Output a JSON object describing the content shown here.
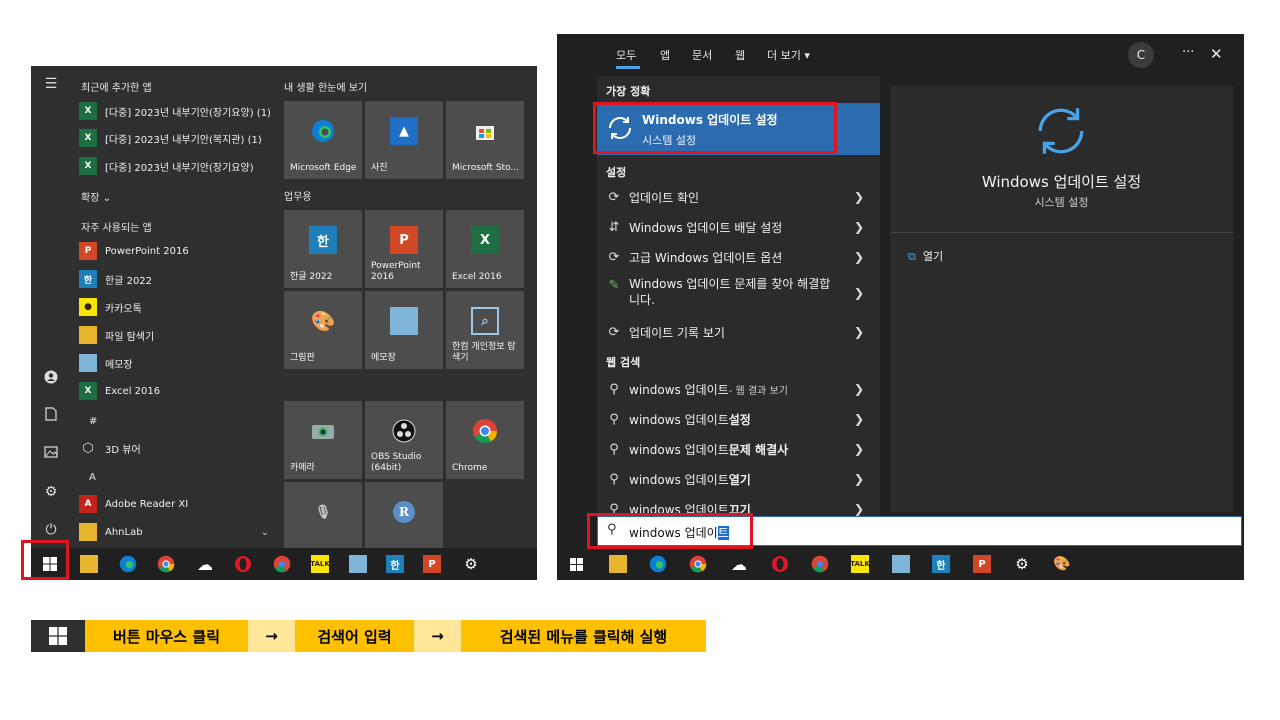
{
  "start_menu": {
    "recent_header": "최근에 추가한 앱",
    "recent": [
      "[다중] 2023년 내부기안(장기요양) (1)",
      "[다중] 2023년 내부기안(복지관) (1)",
      "[다중] 2023년 내부기안(장기요양)"
    ],
    "expand": "확장",
    "frequent_header": "자주 사용되는 앱",
    "frequent": [
      "PowerPoint 2016",
      "한글 2022",
      "카카오톡",
      "파일 탐색기",
      "메모장",
      "Excel 2016"
    ],
    "letter_hash": "#",
    "item_3d": "3D 뷰어",
    "letter_a": "A",
    "adobe": "Adobe Reader XI",
    "ahnlab": "AhnLab",
    "group1": "내 생활 한눈에 보기",
    "tiles1": [
      "Microsoft Edge",
      "사진",
      "Microsoft Sto..."
    ],
    "group2": "업무용",
    "tiles2": [
      "한글 2022",
      "PowerPoint 2016",
      "Excel 2016"
    ],
    "tiles3": [
      "그림판",
      "메모장",
      "한컴 개인정보 탐색기"
    ],
    "tiles4": [
      "카메라",
      "OBS Studio (64bit)",
      "Chrome"
    ]
  },
  "search": {
    "tabs": [
      "모두",
      "앱",
      "문서",
      "웹",
      "더 보기"
    ],
    "user_initial": "C",
    "more": "···",
    "close": "✕",
    "best_match_header": "가장 정확",
    "best_title": "Windows 업데이트 설정",
    "best_sub": "시스템 설정",
    "settings_header": "설정",
    "settings": [
      "업데이트 확인",
      "Windows 업데이트 배달 설정",
      "고급 Windows 업데이트 옵션",
      "Windows 업데이트 문제를 찾아 해결합니다.",
      "업데이트 기록 보기"
    ],
    "web_header": "웹 검색",
    "web_prefix": "windows 업데이트",
    "web": [
      {
        "bold": "",
        "rest": " - 웹 결과 보기"
      },
      {
        "bold": " 설정",
        "rest": ""
      },
      {
        "bold": " 문제 해결사",
        "rest": ""
      },
      {
        "bold": " 열기",
        "rest": ""
      },
      {
        "bold": " 끄기",
        "rest": ""
      }
    ],
    "preview_title": "Windows 업데이트 설정",
    "preview_sub": "시스템 설정",
    "open_label": "열기",
    "query_prefix": "windows 업데이",
    "query_selected": "트"
  },
  "caption": {
    "step1": "버튼 마우스 클릭",
    "arrow": "→",
    "step2": "검색어 입력",
    "step3": "검색된 메뉴를 클릭해 실행"
  },
  "colors": {
    "accent_red": "#e0141e",
    "highlight_blue": "#2b6cb0",
    "caption_yellow": "#ffc000",
    "arrow_yellow": "#ffe699"
  }
}
